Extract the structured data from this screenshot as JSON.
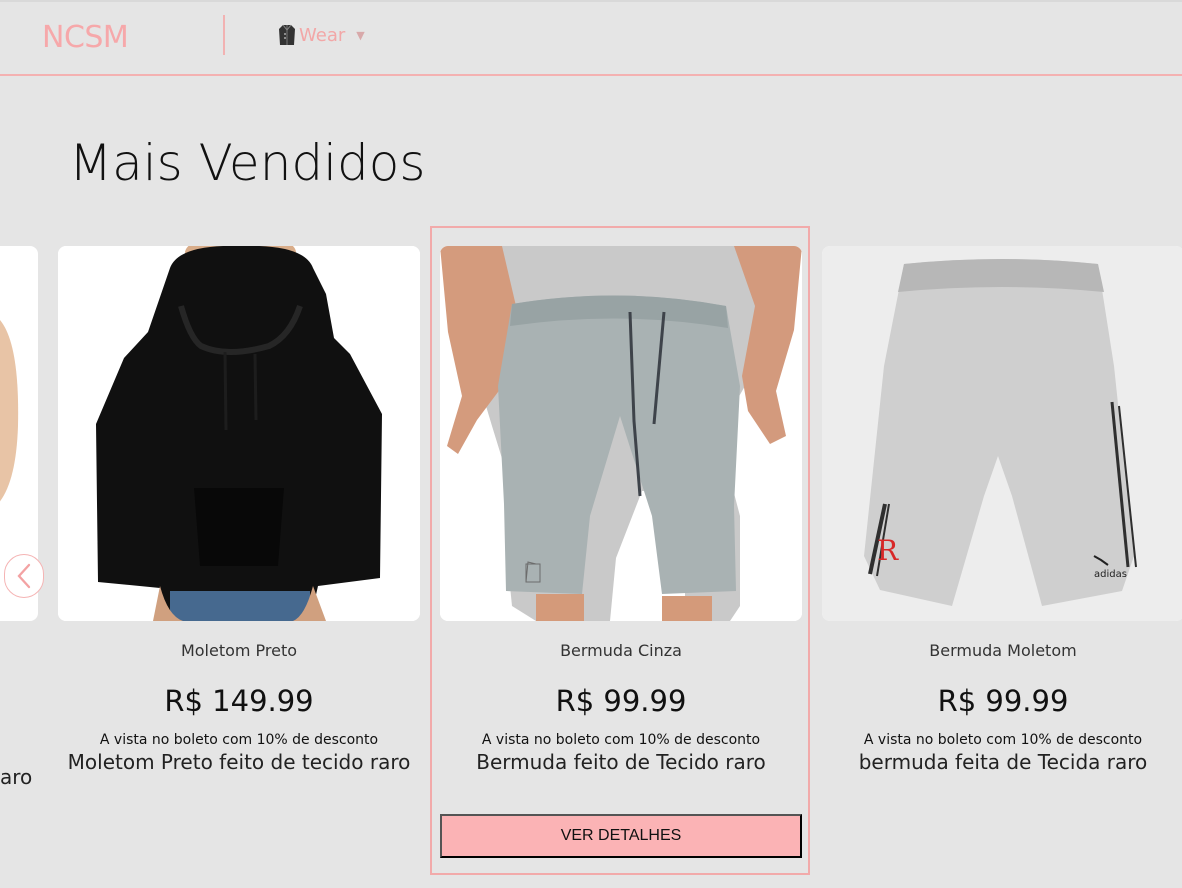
{
  "header": {
    "logo": "NCSM",
    "nav": {
      "label": "Wear"
    }
  },
  "section": {
    "title": "Mais Vendidos"
  },
  "carousel": {
    "peek_text": "aro",
    "products": [
      {
        "name": "Moletom Preto",
        "price": "R$ 149.99",
        "installment_note": "A vista no boleto com 10% de desconto",
        "description": "Moletom Preto feito de tecido raro"
      },
      {
        "name": "Bermuda Cinza",
        "price": "R$ 99.99",
        "installment_note": "A vista no boleto com 10% de desconto",
        "description": "Bermuda feito de Tecido raro",
        "cta": "VER DETALHES"
      },
      {
        "name": "Bermuda Moletom",
        "price": "R$ 99.99",
        "installment_note": "A vista no boleto com 10% de desconto",
        "description": "bermuda feita de Tecida raro"
      }
    ]
  },
  "colors": {
    "accent": "#f6a8aa",
    "cta": "#fbb3b5",
    "background": "#e5e5e5"
  }
}
